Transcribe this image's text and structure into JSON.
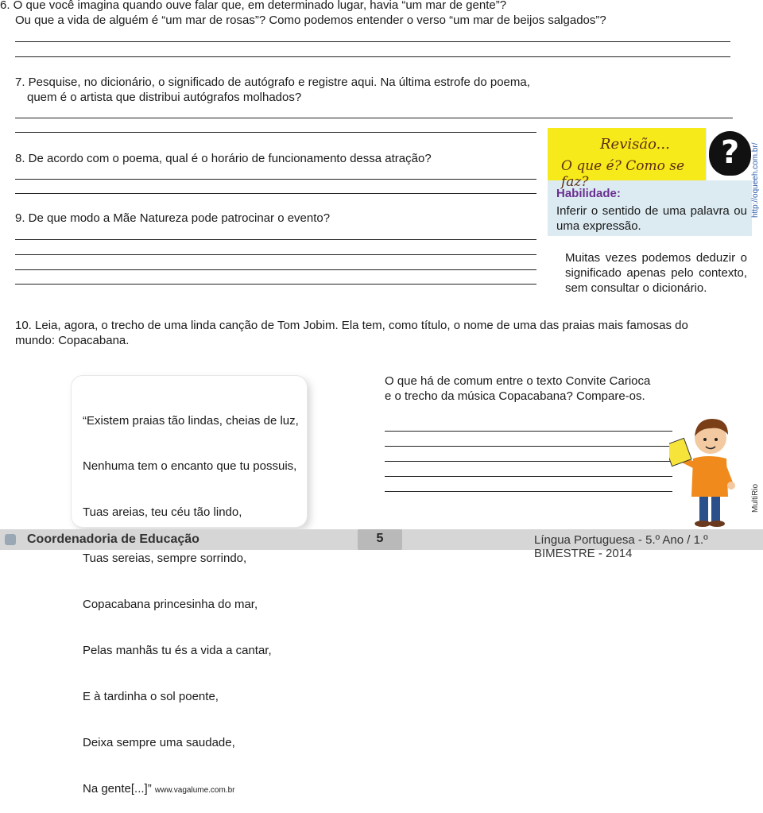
{
  "questions": {
    "q6_line1": "6. O que você imagina quando ouve falar que, em determinado lugar, havia “um mar de gente”?",
    "q6_line2": "Ou que a vida de alguém é “um mar de rosas”? Como podemos entender  o verso “um mar de beijos salgados”?",
    "q7_line1": "7. Pesquise, no dicionário, o significado de autógrafo e registre aqui. Na última estrofe do poema,",
    "q7_line2": "quem é o artista que distribui autógrafos molhados?",
    "q8": "8. De acordo com o poema, qual é o horário de funcionamento dessa atração?",
    "q9": "9. De que modo a Mãe Natureza pode patrocinar o evento?",
    "q10_line1": "10. Leia, agora, o trecho de uma linda canção de Tom Jobim. Ela tem, como título, o nome de uma das praias mais famosas do",
    "q10_line2": "mundo: Copacabana."
  },
  "revisao": {
    "title1": "Revisão...",
    "title2": "O que é? Como se faz?",
    "qmark": "?",
    "habilidade_label": "Habilidade:",
    "habilidade_text": "Inferir o sentido de uma palavra ou uma expressão.",
    "credit": "http://oqueeh.com.br/"
  },
  "tip": "Muitas vezes podemos deduzir o significado apenas pelo contexto, sem consultar o dicionário.",
  "poem": {
    "lines": [
      "“Existem praias tão lindas, cheias de luz,",
      "Nenhuma tem o encanto que tu possuis,",
      "Tuas areias, teu céu tão lindo,",
      "Tuas sereias, sempre sorrindo,",
      "Copacabana princesinha do mar,",
      "Pelas manhãs tu és a vida a cantar,",
      "E à tardinha o sol poente,",
      "Deixa sempre uma saudade,",
      "Na gente[...]”"
    ],
    "source": "www.vagalume.com.br"
  },
  "compare": {
    "line1": "O que há de comum  entre o texto Convite Carioca",
    "line2": "e o trecho da música  Copacabana? Compare-os."
  },
  "illustration_credit": "MultiRio",
  "footer": {
    "left": "Coordenadoria de Educação",
    "page": "5",
    "right": "Língua Portuguesa - 5.º Ano / 1.º BIMESTRE - 2014"
  },
  "colors": {
    "revisao_bg": "#dcebf2",
    "revisao_head": "#f7ea1a",
    "habilidade": "#6a2f8e",
    "footer": "#d6d6d6"
  }
}
